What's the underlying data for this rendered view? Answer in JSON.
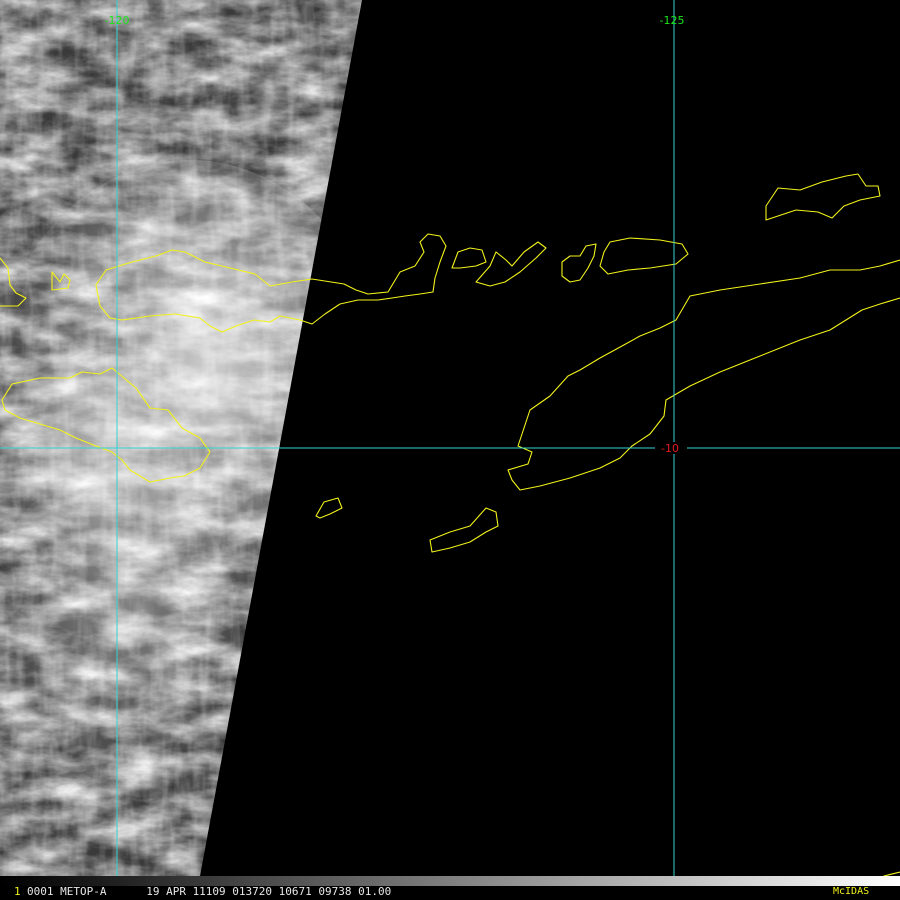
{
  "colors": {
    "gridline": "#35d3d3",
    "coastline": "#f2f21a",
    "longitude_label": "#19e619",
    "latitude_label": "#e61a1a",
    "frame_number": "#f2f21a",
    "status_text": "#e8e8e8",
    "brand": "#f2f21a"
  },
  "grid": {
    "longitudes": [
      {
        "label": "-120"
      },
      {
        "label": "-125"
      }
    ],
    "latitudes": [
      {
        "label": "-10"
      }
    ]
  },
  "image": {
    "type": "satellite image, visible channel",
    "coverage": "cloudy swath on left, no-data (black) region to the right of a diagonal edge",
    "overlays": [
      "latitude/longitude grid",
      "coastlines"
    ]
  },
  "status_bar": {
    "frame_number": "1",
    "text": "0001 METOP-A      19 APR 11109 013720 10671 09738 01.00",
    "brand": "McIDAS"
  }
}
